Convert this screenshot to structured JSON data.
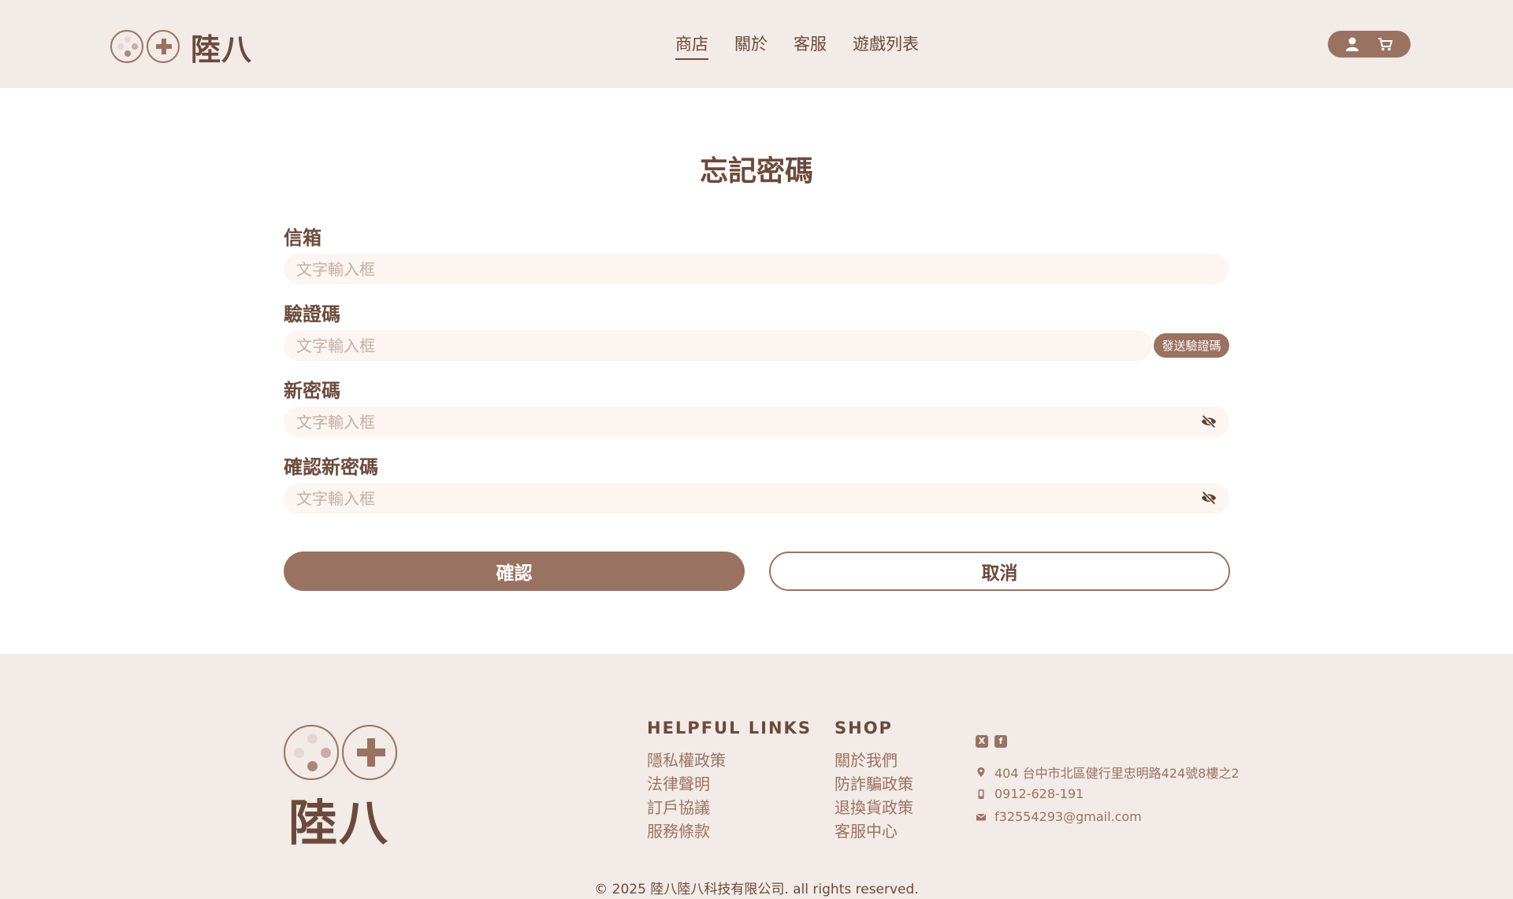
{
  "header": {
    "logo_text": "陸八",
    "nav": [
      "商店",
      "關於",
      "客服",
      "遊戲列表"
    ]
  },
  "form": {
    "title": "忘記密碼",
    "email_label": "信箱",
    "email_placeholder": "文字輸入框",
    "code_label": "驗證碼",
    "code_placeholder": "文字輸入框",
    "send_code_label": "發送驗證碼",
    "new_password_label": "新密碼",
    "new_password_placeholder": "文字輸入框",
    "confirm_password_label": "確認新密碼",
    "confirm_password_placeholder": "文字輸入框",
    "confirm_button": "確認",
    "cancel_button": "取消"
  },
  "footer": {
    "logo_text": "陸八",
    "helpful": {
      "heading": "HELPFUL LINKS",
      "links": [
        "隱私權政策",
        "法律聲明",
        "訂戶協議",
        "服務條款"
      ]
    },
    "shop": {
      "heading": "SHOP",
      "links": [
        "關於我們",
        "防詐騙政策",
        "退換貨政策",
        "客服中心"
      ]
    },
    "contact": {
      "address": "404 台中市北區健行里忠明路424號8樓之2",
      "phone": "0912-628-191",
      "email": "f32554293@gmail.com"
    },
    "copyright": "© 2025 陸八陸八科技有限公司. all rights reserved."
  },
  "colors": {
    "brand": "#9a7262",
    "text_dark": "#6b4a3c",
    "header_bg": "#f2ebe8",
    "input_bg": "#fdf5f2"
  },
  "icons": [
    "user-icon",
    "cart-icon",
    "eye-off-icon",
    "x-icon",
    "facebook-icon",
    "location-icon",
    "phone-icon",
    "mail-icon"
  ]
}
